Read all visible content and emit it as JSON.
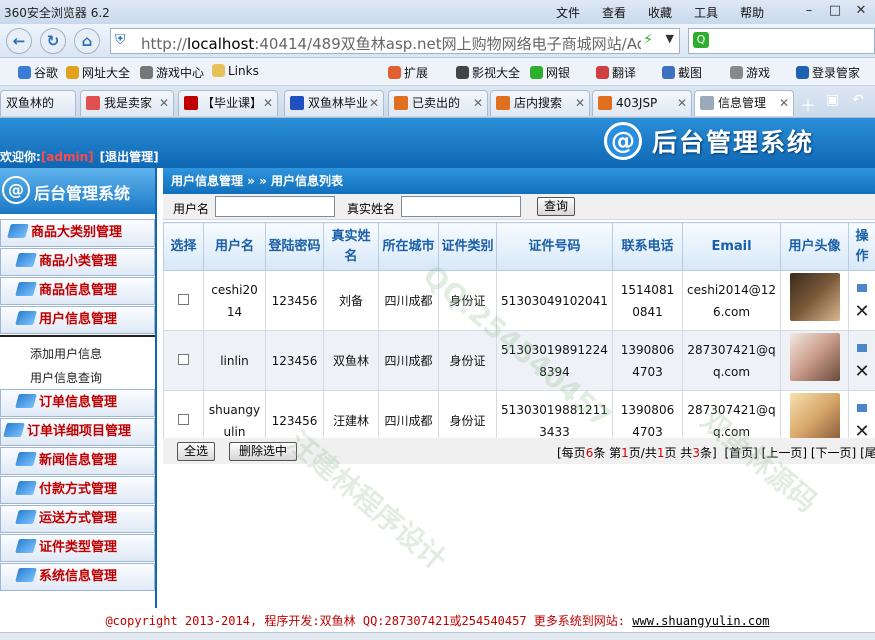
{
  "browser": {
    "title": "360安全浏览器 6.2",
    "menus": [
      "文件",
      "查看",
      "收藏",
      "工具",
      "帮助"
    ],
    "url_prefix": "http://",
    "url_host": "localhost",
    "url_rest": ":40414/489双鱼林asp.net网上购物网络电子商城网站/Adm",
    "bookmarks": [
      {
        "label": "谷歌",
        "icon": "google-icon",
        "color": "#3a7bd5"
      },
      {
        "label": "网址大全",
        "icon": "star-icon",
        "color": "#e0a020"
      },
      {
        "label": "游戏中心",
        "icon": "gamepad-icon",
        "color": "#777777"
      },
      {
        "label": "Links",
        "icon": "folder-icon",
        "color": "#e7c25b"
      },
      {
        "label": "扩展",
        "icon": "extension-icon",
        "color": "#e06030"
      },
      {
        "label": "影视大全",
        "icon": "video-icon",
        "color": "#444444"
      },
      {
        "label": "网银",
        "icon": "bank-icon",
        "color": "#2eae2e"
      },
      {
        "label": "翻译",
        "icon": "translate-icon",
        "color": "#d04040"
      },
      {
        "label": "截图",
        "icon": "scissors-icon",
        "color": "#4070c0"
      },
      {
        "label": "游戏",
        "icon": "game-icon",
        "color": "#888888"
      },
      {
        "label": "登录管家",
        "icon": "key-icon",
        "color": "#2060b0"
      }
    ],
    "tabs": [
      {
        "label": "双鱼林的",
        "color": "#5a8fd0"
      },
      {
        "label": "我是卖家",
        "color": "#e05050"
      },
      {
        "label": "【毕业课】",
        "color": "#c00000"
      },
      {
        "label": "双鱼林毕业",
        "color": "#2050c0"
      },
      {
        "label": "已卖出的",
        "color": "#e07020"
      },
      {
        "label": "店内搜索",
        "color": "#e07020"
      },
      {
        "label": "403JSP",
        "color": "#e07020"
      },
      {
        "label": "信息管理",
        "color": "#9aaabb"
      }
    ]
  },
  "header": {
    "welcome": "欢迎你:",
    "user": "[admin]",
    "logout": "[退出管理]",
    "system_title": "后台管理系统",
    "at_symbol": "@"
  },
  "sidebar": {
    "brand": "后台管理系统",
    "items": [
      {
        "label": "商品大类别管理"
      },
      {
        "label": "商品小类管理"
      },
      {
        "label": "商品信息管理"
      },
      {
        "label": "用户信息管理"
      }
    ],
    "sub_items": [
      "添加用户信息",
      "用户信息查询"
    ],
    "items_after": [
      {
        "label": "订单信息管理"
      },
      {
        "label": "订单详细项目管理"
      },
      {
        "label": "新闻信息管理"
      },
      {
        "label": "付款方式管理"
      },
      {
        "label": "运送方式管理"
      },
      {
        "label": "证件类型管理"
      },
      {
        "label": "系统信息管理"
      }
    ]
  },
  "main": {
    "breadcrumb": "用户信息管理 » » 用户信息列表",
    "search": {
      "username_label": "用户名",
      "username_value": "",
      "realname_label": "真实姓名",
      "realname_value": "",
      "query_button": "查询"
    },
    "columns": [
      "选择",
      "用户名",
      "登陆密码",
      "真实姓名",
      "所在城市",
      "证件类别",
      "证件号码",
      "联系电话",
      "Email",
      "用户头像",
      "操作"
    ],
    "rows": [
      {
        "username": "ceshi2014",
        "password": "123456",
        "realname": "刘备",
        "city": "四川成都",
        "cardtype": "身份证",
        "cardno": "51303049102041",
        "phone": "15140810841",
        "email": "ceshi2014@126.com",
        "avatar_color": "#7a5a3a"
      },
      {
        "username": "linlin",
        "password": "123456",
        "realname": "双鱼林",
        "city": "四川成都",
        "cardtype": "身份证",
        "cardno": "513030198912248394",
        "phone": "13908064703",
        "email": "287307421@qq.com",
        "avatar_color": "#c89a8a"
      },
      {
        "username": "shuangyulin",
        "password": "123456",
        "realname": "汪建林",
        "city": "四川成都",
        "cardtype": "身份证",
        "cardno": "513030198812113433",
        "phone": "13908064703",
        "email": "287307421@qq.com",
        "avatar_color": "#d8a86a"
      }
    ],
    "select_all_button": "全选",
    "delete_selected_button": "删除选中",
    "pager": {
      "per_page_prefix": "[每页",
      "per_page": "6",
      "per_page_mid": "条 第",
      "current": "1",
      "of": "页/共",
      "total_pages": "1",
      "total_mid": "页 共",
      "total_items": "3",
      "total_suffix": "条]",
      "first": "[首页]",
      "prev": "[上一页]",
      "next": "[下一页]",
      "last": "[尾页]"
    }
  },
  "footer": {
    "copyright": "@copyright 2013-2014, 程序开发:双鱼林  QQ:287307421或254540457  更多系统到网站: ",
    "site": "www.shuangyulin.com"
  },
  "watermarks": [
    "汪建林程序设计",
    "QQ:254540457",
    "双鱼林源码"
  ],
  "colors": {
    "accent": "#0f67b4",
    "menu_text": "#c00000",
    "header_text": "#1a5fa8"
  }
}
